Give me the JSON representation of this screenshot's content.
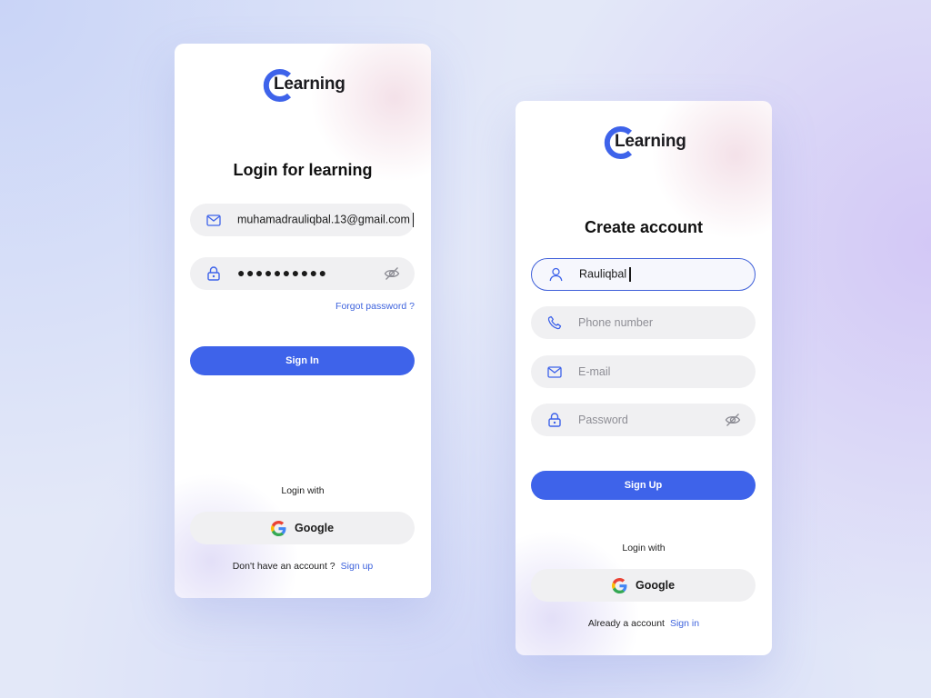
{
  "colors": {
    "accent": "#3e63ea",
    "field_bg": "#f0f0f2",
    "link": "#3e63dd"
  },
  "login": {
    "logo_text": "Learning",
    "title": "Login for learning",
    "email_value": "muhamadrauliqbal.13@gmail.com",
    "password_value": "●●●●●●●●●●",
    "forgot_label": "Forgot password ?",
    "signin_label": "Sign In",
    "login_with": "Login with",
    "google_label": "Google",
    "footer_text": "Don't have an account ?",
    "footer_link": "Sign up"
  },
  "signup": {
    "logo_text": "Learning",
    "title": "Create account",
    "name_value": "Rauliqbal",
    "phone_placeholder": "Phone number",
    "email_placeholder": "E-mail",
    "password_placeholder": "Password",
    "signup_label": "Sign Up",
    "login_with": "Login with",
    "google_label": "Google",
    "footer_text": "Already a account",
    "footer_link": "Sign in"
  }
}
